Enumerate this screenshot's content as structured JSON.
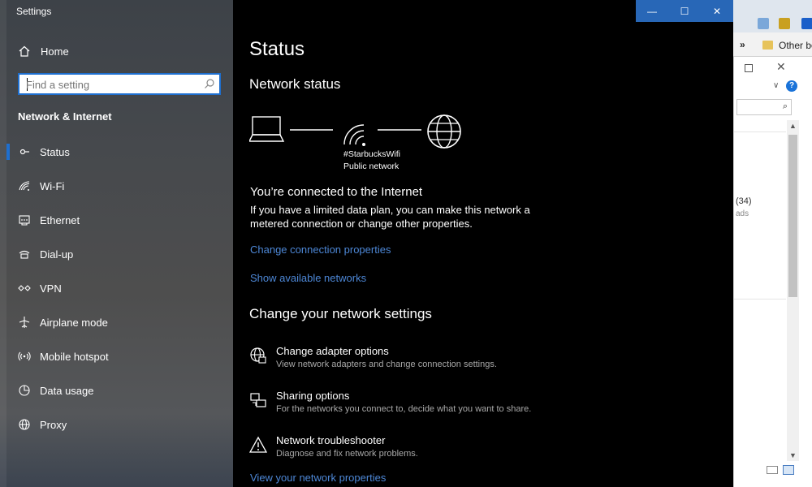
{
  "window": {
    "title": "Settings"
  },
  "titlebar": {
    "minimize": "—",
    "maximize": "☐",
    "close": "✕"
  },
  "sidebar": {
    "home_label": "Home",
    "search_placeholder": "Find a setting",
    "section_title": "Network & Internet",
    "items": [
      {
        "label": "Status",
        "icon": "status-icon",
        "active": true
      },
      {
        "label": "Wi-Fi",
        "icon": "wifi-icon"
      },
      {
        "label": "Ethernet",
        "icon": "ethernet-icon"
      },
      {
        "label": "Dial-up",
        "icon": "dialup-icon"
      },
      {
        "label": "VPN",
        "icon": "vpn-icon"
      },
      {
        "label": "Airplane mode",
        "icon": "airplane-icon"
      },
      {
        "label": "Mobile hotspot",
        "icon": "hotspot-icon"
      },
      {
        "label": "Data usage",
        "icon": "data-usage-icon"
      },
      {
        "label": "Proxy",
        "icon": "proxy-icon"
      }
    ]
  },
  "main": {
    "title": "Status",
    "network_status_heading": "Network status",
    "network_name": "#StarbucksWifi",
    "network_type": "Public network",
    "connected_heading": "You’re connected to the Internet",
    "connected_desc": "If you have a limited data plan, you can make this network a metered connection or change other properties.",
    "link_change_connection": "Change connection properties",
    "link_show_networks": "Show available networks",
    "change_settings_heading": "Change your network settings",
    "options": [
      {
        "title": "Change adapter options",
        "subtitle": "View network adapters and change connection settings.",
        "icon": "adapter-icon"
      },
      {
        "title": "Sharing options",
        "subtitle": "For the networks you connect to, decide what you want to share.",
        "icon": "sharing-icon"
      },
      {
        "title": "Network troubleshooter",
        "subtitle": "Diagnose and fix network problems.",
        "icon": "warning-icon"
      }
    ],
    "link_view_properties": "View your network properties"
  },
  "background": {
    "bookmarks_chevron": "»",
    "bookmarks_label": "Other bo",
    "help_glyph": "?",
    "explorer_count": "(34)",
    "explorer_sub": "ads"
  },
  "colors": {
    "accent": "#2867b7",
    "link": "#4d87d6",
    "sidebar_bg": "#4a4c4f",
    "main_bg": "#000000"
  }
}
